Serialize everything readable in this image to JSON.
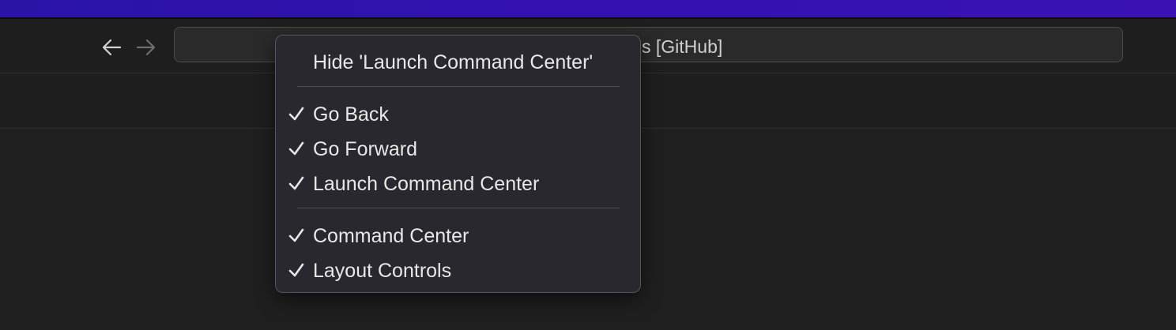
{
  "titlebar": {
    "back_icon": "arrow-left-icon",
    "forward_icon": "arrow-right-icon",
    "command_center_visible_text": "s [GitHub]"
  },
  "context_menu": {
    "items": [
      {
        "label": "Hide 'Launch Command Center'",
        "checked": false
      },
      {
        "label": "Go Back",
        "checked": true
      },
      {
        "label": "Go Forward",
        "checked": true
      },
      {
        "label": "Launch Command Center",
        "checked": true
      },
      {
        "label": "Command Center",
        "checked": true
      },
      {
        "label": "Layout Controls",
        "checked": true
      }
    ]
  },
  "colors": {
    "accent_strip": "#3311b0",
    "menu_background": "#29282e",
    "window_background": "#1f1f1f"
  }
}
